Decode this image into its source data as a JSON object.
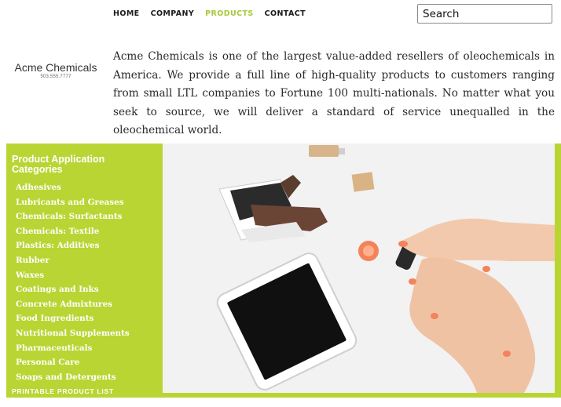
{
  "nav": {
    "items": [
      {
        "label": "HOME",
        "active": false
      },
      {
        "label": "COMPANY",
        "active": false
      },
      {
        "label": "PRODUCTS",
        "active": true
      },
      {
        "label": "CONTACT",
        "active": false
      }
    ]
  },
  "search": {
    "placeholder": "Search"
  },
  "brand": {
    "name": "Acme Chemicals",
    "phone": "503.555.7777"
  },
  "intro": {
    "text": "Acme Chemicals is one of the largest value-added resellers of oleochemicals in America. We provide a full line of high-quality products to customers ranging from small LTL companies to Fortune 100 multi-nationals. No matter what you seek to source, we will deliver a standard of service unequalled in the oleochemical world."
  },
  "sidebar": {
    "heading": "Product Application Categories",
    "categories": [
      "Adhesives",
      "Lubricants and Greases",
      "Chemicals: Surfactants",
      "Chemicals: Textile",
      "Plastics: Additives",
      "Rubber",
      "Waxes",
      "Coatings and Inks",
      "Concrete Admixtures",
      "Food Ingredients",
      "Nutritional Supplements",
      "Pharmaceuticals",
      "Personal Care",
      "Soaps and Detergents"
    ],
    "printable_label": "PRINTABLE PRODUCT LIST"
  },
  "colors": {
    "accent_green": "#b9d534",
    "active_nav": "#a8c83a",
    "nail_polish": "#f4825a"
  },
  "hero": {
    "icons": [
      "chocolate-bar-icon",
      "tablet-icon",
      "nail-polish-bottle-icon",
      "hand-icon",
      "usb-drive-icon",
      "wooden-block-icon"
    ]
  }
}
